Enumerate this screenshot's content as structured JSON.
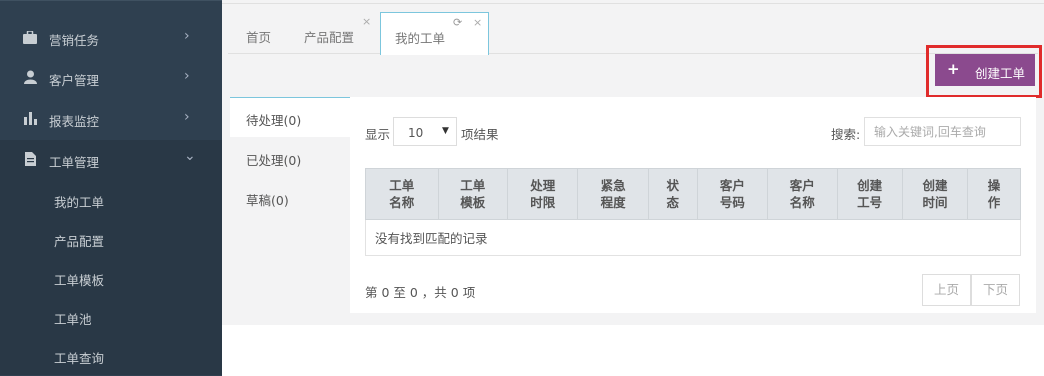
{
  "sidebar": {
    "items": [
      {
        "label": "营销任务",
        "icon": "briefcase-icon",
        "arrow": "›"
      },
      {
        "label": "客户管理",
        "icon": "user-icon",
        "arrow": "›"
      },
      {
        "label": "报表监控",
        "icon": "bar-chart-icon",
        "arrow": "›"
      },
      {
        "label": "工单管理",
        "icon": "file-icon",
        "arrow": "⌄"
      }
    ],
    "subitems": [
      {
        "label": "我的工单"
      },
      {
        "label": "产品配置"
      },
      {
        "label": "工单模板"
      },
      {
        "label": "工单池"
      },
      {
        "label": "工单查询"
      }
    ]
  },
  "tabs": [
    {
      "label": "首页"
    },
    {
      "label": "产品配置",
      "close": "×"
    },
    {
      "label": "我的工单",
      "close": "×",
      "refresh": "⟳"
    }
  ],
  "toolbar": {
    "create_label": "创建工单",
    "create_icon": "+"
  },
  "subnav": [
    {
      "label": "待处理(0)"
    },
    {
      "label": "已处理(0)"
    },
    {
      "label": "草稿(0)"
    }
  ],
  "table_controls": {
    "show_label": "显示",
    "page_size": "10",
    "items_label": "项结果",
    "search_label": "搜索:",
    "search_placeholder": "输入关键词,回车查询"
  },
  "table": {
    "headers": [
      [
        "工单",
        "名称"
      ],
      [
        "工单",
        "模板"
      ],
      [
        "处理",
        "时限"
      ],
      [
        "紧急",
        "程度"
      ],
      [
        "状",
        "态"
      ],
      [
        "客户",
        "号码"
      ],
      [
        "客户",
        "名称"
      ],
      [
        "创建",
        "工号"
      ],
      [
        "创建",
        "时间"
      ],
      [
        "操",
        "作"
      ]
    ],
    "empty_text": "没有找到匹配的记录"
  },
  "pagination": {
    "info": "第 0 至 0 ，共 0 项",
    "prev": "上页",
    "next": "下页"
  },
  "colors": {
    "sidebar_bg": "#2f4050",
    "accent_purple": "#8b4a8e",
    "highlight_red": "#e02b2b",
    "tab_border": "#7cc6dd"
  }
}
